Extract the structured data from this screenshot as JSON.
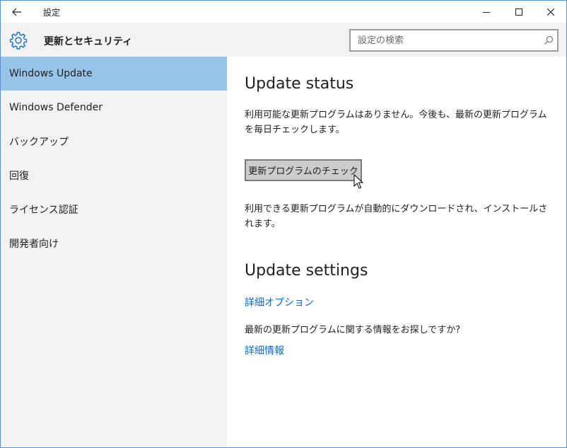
{
  "window": {
    "title": "設定"
  },
  "header": {
    "title": "更新とセキュリティ",
    "search_placeholder": "設定の検索"
  },
  "sidebar": {
    "items": [
      {
        "label": "Windows Update",
        "selected": true
      },
      {
        "label": "Windows Defender",
        "selected": false
      },
      {
        "label": "バックアップ",
        "selected": false
      },
      {
        "label": "回復",
        "selected": false
      },
      {
        "label": "ライセンス認証",
        "selected": false
      },
      {
        "label": "開発者向け",
        "selected": false
      }
    ]
  },
  "main": {
    "status_title": "Update status",
    "status_text": "利用可能な更新プログラムはありません。今後も、最新の更新プログラムを毎日チェックします。",
    "check_button_label": "更新プログラムのチェック",
    "auto_text": "利用できる更新プログラムが自動的にダウンロードされ、インストールされます。",
    "settings_title": "Update settings",
    "advanced_link": "詳細オプション",
    "info_question": "最新の更新プログラムに関する情報をお探しですか?",
    "info_link": "詳細情報"
  },
  "colors": {
    "accent": "#0b6bc9",
    "selected_item": "#99c4ea",
    "sidebar_bg": "#f2f2f2"
  },
  "icons": {
    "back": "back-arrow-icon",
    "minimize": "minimize-icon",
    "maximize": "maximize-icon",
    "close": "close-icon",
    "header": "gear-icon",
    "search": "search-icon"
  }
}
